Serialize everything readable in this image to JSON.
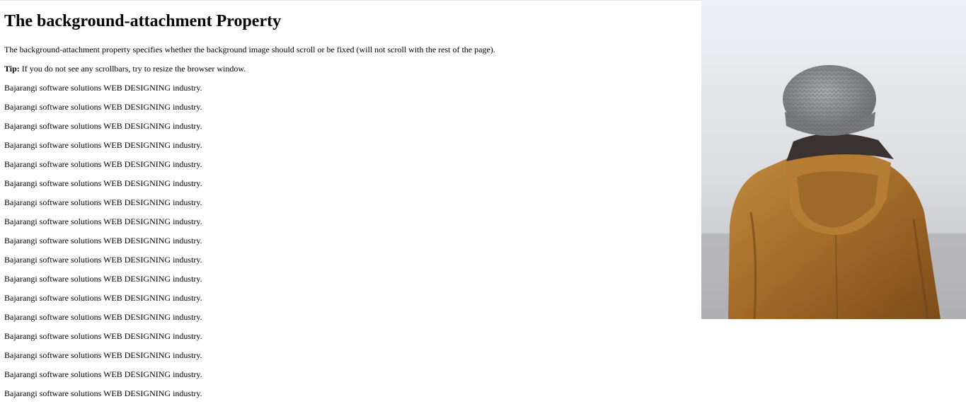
{
  "page": {
    "title": "The background-attachment Property",
    "intro": "The background-attachment property specifies whether the background image should scroll or be fixed (will not scroll with the rest of the page).",
    "tip_label": "Tip:",
    "tip_text": " If you do not see any scrollbars, try to resize the browser window.",
    "repeated_lines": [
      "Bajarangi software solutions WEB DESIGNING industry.",
      "Bajarangi software solutions WEB DESIGNING industry.",
      "Bajarangi software solutions WEB DESIGNING industry.",
      "Bajarangi software solutions WEB DESIGNING industry.",
      "Bajarangi software solutions WEB DESIGNING industry.",
      "Bajarangi software solutions WEB DESIGNING industry.",
      "Bajarangi software solutions WEB DESIGNING industry.",
      "Bajarangi software solutions WEB DESIGNING industry.",
      "Bajarangi software solutions WEB DESIGNING industry.",
      "Bajarangi software solutions WEB DESIGNING industry.",
      "Bajarangi software solutions WEB DESIGNING industry.",
      "Bajarangi software solutions WEB DESIGNING industry.",
      "Bajarangi software solutions WEB DESIGNING industry.",
      "Bajarangi software solutions WEB DESIGNING industry.",
      "Bajarangi software solutions WEB DESIGNING industry.",
      "Bajarangi software solutions WEB DESIGNING industry.",
      "Bajarangi software solutions WEB DESIGNING industry."
    ]
  },
  "background_image": {
    "subject": "person-in-knit-hat-and-brown-jacket-back-view",
    "colors": {
      "sky_top": "#eeeff3",
      "fog": "#d8d9dc",
      "jacket": "#a86e2c",
      "jacket_shadow": "#7a4c1c",
      "hat": "#8a8c90",
      "scarf": "#3a3230"
    }
  }
}
